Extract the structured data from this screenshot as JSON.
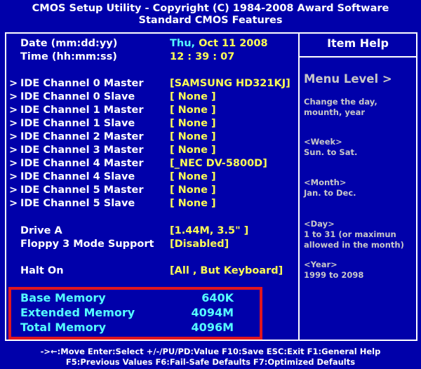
{
  "header": {
    "line1": "CMOS Setup Utility - Copyright (C) 1984-2008 Award Software",
    "line2": "Standard CMOS Features"
  },
  "date": {
    "label": "Date (mm:dd:yy)",
    "day": "Thu, ",
    "value": "Oct 11  2008"
  },
  "time": {
    "label": "Time (hh:mm:ss)",
    "value": "12 : 39 : 07"
  },
  "ide": [
    {
      "label": "IDE Channel 0 Master",
      "value": "[SAMSUNG HD321KJ]"
    },
    {
      "label": "IDE Channel 0 Slave",
      "value": "[  None ]"
    },
    {
      "label": "IDE Channel 1 Master",
      "value": "[  None ]"
    },
    {
      "label": "IDE Channel 1 Slave",
      "value": "[  None ]"
    },
    {
      "label": "IDE Channel 2 Master",
      "value": "[  None ]"
    },
    {
      "label": "IDE Channel 3 Master",
      "value": "[  None ]"
    },
    {
      "label": "IDE Channel 4 Master",
      "value": "[_NEC DV-5800D]"
    },
    {
      "label": "IDE Channel 4 Slave",
      "value": "[  None ]"
    },
    {
      "label": "IDE Channel 5 Master",
      "value": "[  None ]"
    },
    {
      "label": "IDE Channel 5 Slave",
      "value": "[  None ]"
    }
  ],
  "arrow_glyph": ">",
  "drive_a": {
    "label": "Drive A",
    "value": "[1.44M, 3.5\" ]"
  },
  "floppy3": {
    "label": "Floppy 3 Mode Support",
    "value": "[Disabled]"
  },
  "halt_on": {
    "label": "Halt On",
    "value": "[All , But Keyboard]"
  },
  "memory": {
    "base": {
      "label": "Base Memory",
      "value": "640K"
    },
    "extended": {
      "label": "Extended Memory",
      "value": "4094M"
    },
    "total": {
      "label": "Total Memory",
      "value": "4096M"
    }
  },
  "help": {
    "title": "Item Help",
    "menu_level": "Menu Level  >",
    "desc1": "Change the day,",
    "desc2": "mounth, year",
    "week_tag": "<Week>",
    "week_desc": "Sun. to Sat.",
    "month_tag": "<Month>",
    "month_desc": "Jan. to Dec.",
    "day_tag": "<Day>",
    "day_desc1": "1 to 31 (or maximun",
    "day_desc2": "allowed in the month)",
    "year_tag": "<Year>",
    "year_desc": "1999 to 2098"
  },
  "footer": {
    "line1": "->←:Move  Enter:Select  +/-/PU/PD:Value  F10:Save   ESC:Exit  F1:General Help",
    "line2": "F5:Previous Values   F6:Fail-Safe Defaults   F7:Optimized Defaults"
  },
  "colors": {
    "background": "#0000aa",
    "text": "#ffffff",
    "value": "#ffff55",
    "highlight": "#55ffff",
    "help_text": "#c8c8c8",
    "annotation_box": "#e0161f"
  }
}
